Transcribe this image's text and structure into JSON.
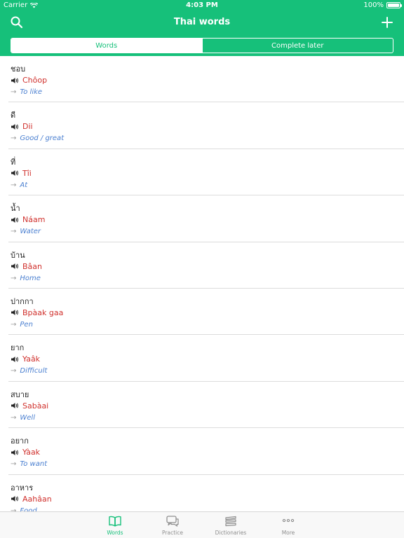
{
  "status_bar": {
    "carrier": "Carrier",
    "time": "4:03 PM",
    "battery_text": "100%",
    "battery_level": 1.0
  },
  "nav": {
    "title": "Thai words",
    "search_icon": "search-icon",
    "add_icon": "plus-icon"
  },
  "segments": [
    {
      "label": "Words",
      "selected": true
    },
    {
      "label": "Complete later",
      "selected": false
    }
  ],
  "words": [
    {
      "thai": "ชอบ",
      "romanized": "Chôop",
      "translation": "To like"
    },
    {
      "thai": "ดี",
      "romanized": "Dii",
      "translation": "Good / great"
    },
    {
      "thai": "ที่",
      "romanized": "Tîi",
      "translation": "At"
    },
    {
      "thai": "น้ำ",
      "romanized": "Náam",
      "translation": "Water"
    },
    {
      "thai": "บ้าน",
      "romanized": "Bâan",
      "translation": "Home"
    },
    {
      "thai": "ปากกา",
      "romanized": "Bpàak gaa",
      "translation": "Pen"
    },
    {
      "thai": "ยาก",
      "romanized": "Yaâk",
      "translation": "Difficult"
    },
    {
      "thai": "สบาย",
      "romanized": "Sabàai",
      "translation": "Well"
    },
    {
      "thai": "อยาก",
      "romanized": "Yàak",
      "translation": "To want"
    },
    {
      "thai": "อาหาร",
      "romanized": "Aahâan",
      "translation": "Food"
    }
  ],
  "arrow_glyph": "→",
  "tabs": [
    {
      "label": "Words",
      "icon": "book-icon",
      "active": true
    },
    {
      "label": "Practice",
      "icon": "chat-bubble-icon",
      "active": false
    },
    {
      "label": "Dictionaries",
      "icon": "stack-icon",
      "active": false
    },
    {
      "label": "More",
      "icon": "more-dots-icon",
      "active": false
    }
  ],
  "colors": {
    "accent": "#16c07a",
    "romanized": "#d0312d",
    "translation": "#4a7fd0"
  }
}
